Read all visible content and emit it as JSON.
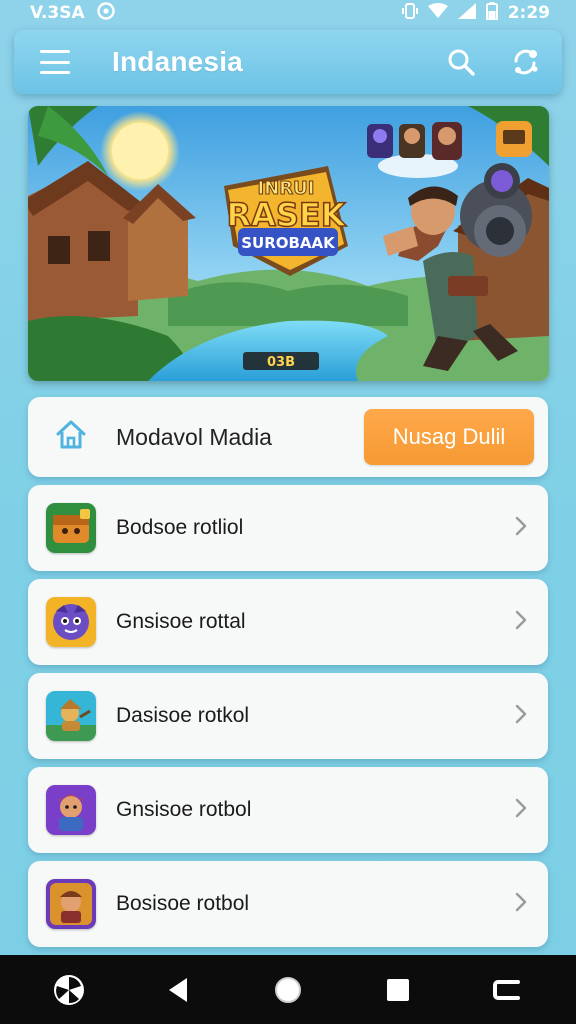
{
  "status_bar": {
    "left_text": "V.3SA",
    "time": "2:29"
  },
  "app_bar": {
    "title": "Indanesia",
    "icons": [
      "menu-icon",
      "search-icon",
      "share-icon"
    ]
  },
  "banner": {
    "game_title_top": "INRUI",
    "game_title_main": "RASEK",
    "game_title_sub": "SUROBAAK",
    "counter": "03B"
  },
  "header_row": {
    "icon": "home-icon",
    "label": "Modavol Madia",
    "button_label": "Nusag Dulil",
    "button_color": "#f59a33"
  },
  "list": {
    "items": [
      {
        "label": "Bodsoe rotliol",
        "icon": "game-icon-treasure"
      },
      {
        "label": "Gnsisoe rottal",
        "icon": "game-icon-purple-hero"
      },
      {
        "label": "Dasisoe rotkol",
        "icon": "game-icon-adventurer"
      },
      {
        "label": "Gnsisoe rotbol",
        "icon": "game-icon-warrior"
      },
      {
        "label": "Bosisoe rotbol",
        "icon": "game-icon-knight"
      }
    ]
  },
  "nav_bar": {
    "icons": [
      "apps-icon",
      "back-icon",
      "home-circle-icon",
      "recents-icon",
      "switch-icon"
    ]
  }
}
